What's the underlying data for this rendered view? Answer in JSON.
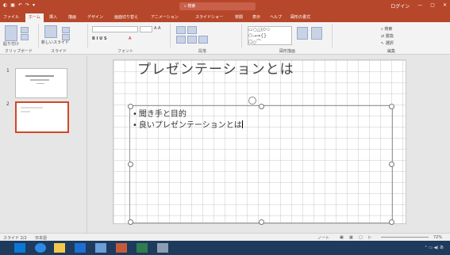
{
  "title_bar": {
    "title": "プレゼンテーション1 - PowerPoint",
    "search": "検索",
    "user": "ログイン"
  },
  "tabs": [
    "ファイル",
    "ホーム",
    "挿入",
    "描画",
    "デザイン",
    "画面切り替え",
    "アニメーション",
    "スライドショー",
    "校閲",
    "表示",
    "ヘルプ",
    "図形の書式"
  ],
  "ribbon": {
    "groups": [
      "クリップボード",
      "スライド",
      "フォント",
      "段落",
      "図形描画",
      "編集"
    ],
    "buttons": {
      "paste": "貼り付け",
      "new_slide": "新しいスライド",
      "find": "検索",
      "replace": "置換",
      "select": "選択"
    }
  },
  "slides": [
    {
      "number": "1",
      "title": "プレゼンテーション"
    },
    {
      "number": "2",
      "title": "プレゼンテーションとは"
    }
  ],
  "current_slide": {
    "title": "プレゼンテーションとは",
    "bullets": [
      "聞き手と目的",
      "良いプレゼンテーションとは"
    ]
  },
  "status": {
    "slide_info": "スライド 2/2",
    "language": "日本語",
    "notes": "ノート",
    "zoom": "72%"
  },
  "accent_color": "#b7472a"
}
